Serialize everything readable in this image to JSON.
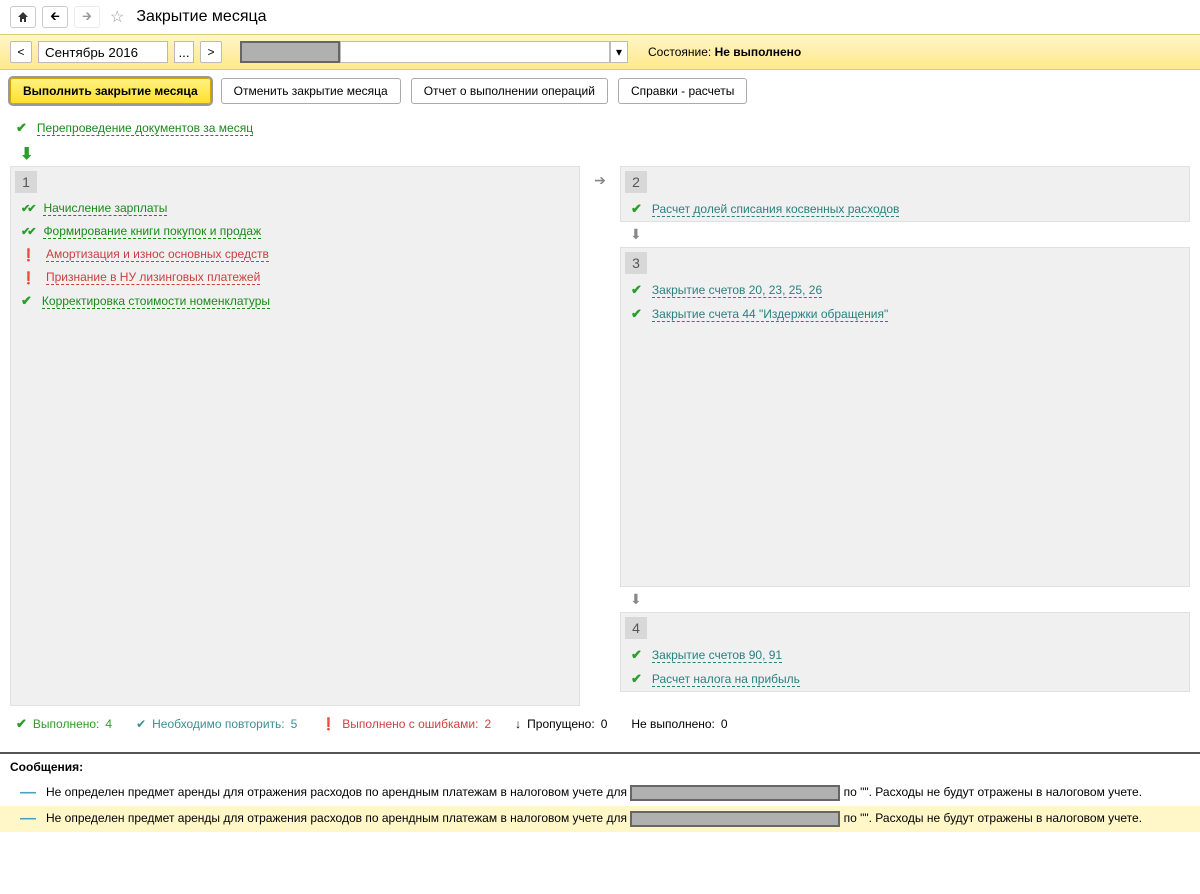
{
  "header": {
    "title": "Закрытие месяца"
  },
  "period": {
    "value": "Сентябрь 2016",
    "state_label": "Состояние:",
    "state_value": "Не выполнено"
  },
  "actions": {
    "primary": "Выполнить закрытие месяца",
    "cancel": "Отменить закрытие месяца",
    "report": "Отчет о выполнении операций",
    "refs": "Справки - расчеты"
  },
  "top_link": "Перепроведение документов за месяц",
  "col1": {
    "num": "1",
    "items": [
      {
        "status": "double",
        "style": "green",
        "label": "Начисление зарплаты"
      },
      {
        "status": "double",
        "style": "green",
        "label": "Формирование книги покупок и продаж"
      },
      {
        "status": "warn",
        "style": "red",
        "label": "Амортизация и износ основных средств"
      },
      {
        "status": "warn",
        "style": "red",
        "label": "Признание в НУ лизинговых платежей"
      },
      {
        "status": "check",
        "style": "green",
        "label": "Корректировка стоимости номенклатуры"
      }
    ]
  },
  "col2_a": {
    "num": "2",
    "items": [
      {
        "status": "check",
        "style": "teal",
        "label": "Расчет долей списания косвенных расходов"
      }
    ]
  },
  "col2_b": {
    "num": "3",
    "items": [
      {
        "status": "check",
        "style": "teal",
        "label": "Закрытие счетов 20, 23, 25, 26"
      },
      {
        "status": "check",
        "style": "teal",
        "label": "Закрытие счета 44 \"Издержки обращения\""
      }
    ]
  },
  "col2_c": {
    "num": "4",
    "items": [
      {
        "status": "check",
        "style": "teal",
        "label": "Закрытие счетов 90, 91"
      },
      {
        "status": "check",
        "style": "teal",
        "label": "Расчет налога на прибыль"
      }
    ]
  },
  "summary": {
    "done_label": "Выполнено:",
    "done_val": "4",
    "repeat_label": "Необходимо повторить:",
    "repeat_val": "5",
    "errors_label": "Выполнено с ошибками:",
    "errors_val": "2",
    "skipped_label": "Пропущено:",
    "skipped_val": "0",
    "notdone_label": "Не выполнено:",
    "notdone_val": "0"
  },
  "messages": {
    "header": "Сообщения:",
    "rows": [
      {
        "pre": "Не определен предмет аренды для отражения расходов  по арендным платежам в налоговом учете для",
        "post": "по \"\". Расходы не будут отражены в налоговом учете."
      },
      {
        "pre": "Не определен предмет аренды для отражения расходов  по арендным платежам в налоговом учете для",
        "post": "по \"\". Расходы не будут отражены в налоговом учете."
      }
    ]
  }
}
